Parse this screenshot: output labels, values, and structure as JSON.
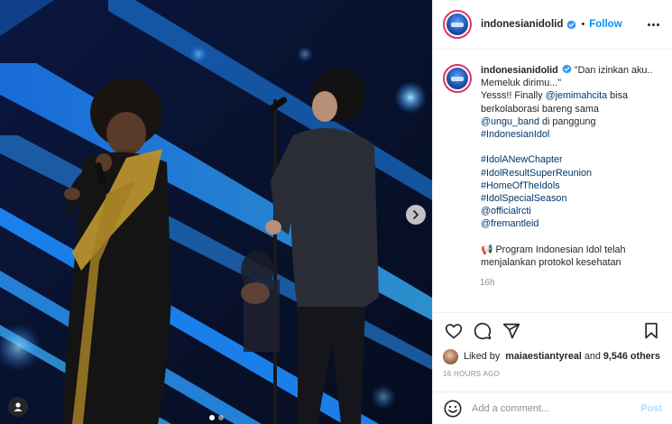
{
  "account": {
    "username": "indonesianidolid",
    "separator": "•",
    "follow_label": "Follow"
  },
  "caption": {
    "username": "indonesianidolid",
    "lines": [
      {
        "parts": [
          {
            "text": "\"Dan izinkan aku..",
            "type": "text"
          }
        ]
      },
      {
        "parts": [
          {
            "text": "Memeluk dirimu...\"",
            "type": "text"
          }
        ]
      },
      {
        "parts": [
          {
            "text": "Yesss!! Finally ",
            "type": "text"
          },
          {
            "text": "@jemimahcita",
            "type": "link"
          },
          {
            "text": " bisa",
            "type": "text"
          }
        ]
      },
      {
        "parts": [
          {
            "text": "berkolaborasi bareng sama",
            "type": "text"
          }
        ]
      },
      {
        "parts": [
          {
            "text": "@ungu_band",
            "type": "link"
          },
          {
            "text": " di panggung",
            "type": "text"
          }
        ]
      },
      {
        "parts": [
          {
            "text": "#IndonesianIdol",
            "type": "link"
          }
        ]
      },
      {
        "parts": []
      },
      {
        "parts": [
          {
            "text": "#IdolANewChapter",
            "type": "link"
          }
        ]
      },
      {
        "parts": [
          {
            "text": "#IdolResultSuperReunion",
            "type": "link"
          }
        ]
      },
      {
        "parts": [
          {
            "text": "#HomeOfTheIdols",
            "type": "link"
          }
        ]
      },
      {
        "parts": [
          {
            "text": "#IdolSpecialSeason",
            "type": "link"
          }
        ]
      },
      {
        "parts": [
          {
            "text": "@officialrcti",
            "type": "link"
          }
        ]
      },
      {
        "parts": [
          {
            "text": "@fremantleid",
            "type": "link"
          }
        ]
      },
      {
        "parts": []
      },
      {
        "parts": [
          {
            "text": "📢 Program Indonesian Idol telah",
            "type": "text"
          }
        ]
      },
      {
        "parts": [
          {
            "text": "menjalankan protokol kesehatan",
            "type": "text"
          }
        ]
      }
    ],
    "age": "16h"
  },
  "likes": {
    "liked_by_label": "Liked by",
    "liker": "maiaestiantyreal",
    "and_label": "and",
    "others": "9,546 others"
  },
  "posted_time": "16 HOURS AGO",
  "comment_box": {
    "placeholder": "Add a comment...",
    "post_label": "Post"
  },
  "carousel": {
    "slides": 2,
    "current": 1
  },
  "colors": {
    "accent": "#0095f6",
    "text": "#262626",
    "muted": "#8e8e8e",
    "link": "#00376b",
    "stage_blue": "#1e8cff",
    "stage_dark": "#0a1330"
  },
  "icons": [
    "verified-badge-icon",
    "more-options-icon",
    "heart-icon",
    "comment-icon",
    "share-icon",
    "bookmark-icon",
    "emoji-icon",
    "next-arrow-icon",
    "user-tag-icon",
    "megaphone-icon"
  ]
}
